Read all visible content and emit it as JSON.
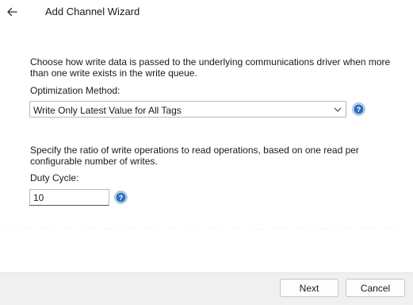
{
  "header": {
    "back_icon": "arrow-left-icon",
    "title": "Add Channel Wizard"
  },
  "optimization": {
    "description": "Choose how write data is passed to the underlying communications driver when more than one write exists in the write queue.",
    "label": "Optimization Method:",
    "selected": "Write Only Latest Value for All Tags",
    "help_icon": "help-icon"
  },
  "duty_cycle": {
    "description": "Specify the ratio of write operations to read operations, based on one read per configurable number of writes.",
    "label": "Duty Cycle:",
    "value": "10",
    "help_icon": "help-icon"
  },
  "footer": {
    "next_label": "Next",
    "cancel_label": "Cancel"
  },
  "colors": {
    "help_blue": "#2b6fbf",
    "footer_bg": "#f0f0f0"
  }
}
